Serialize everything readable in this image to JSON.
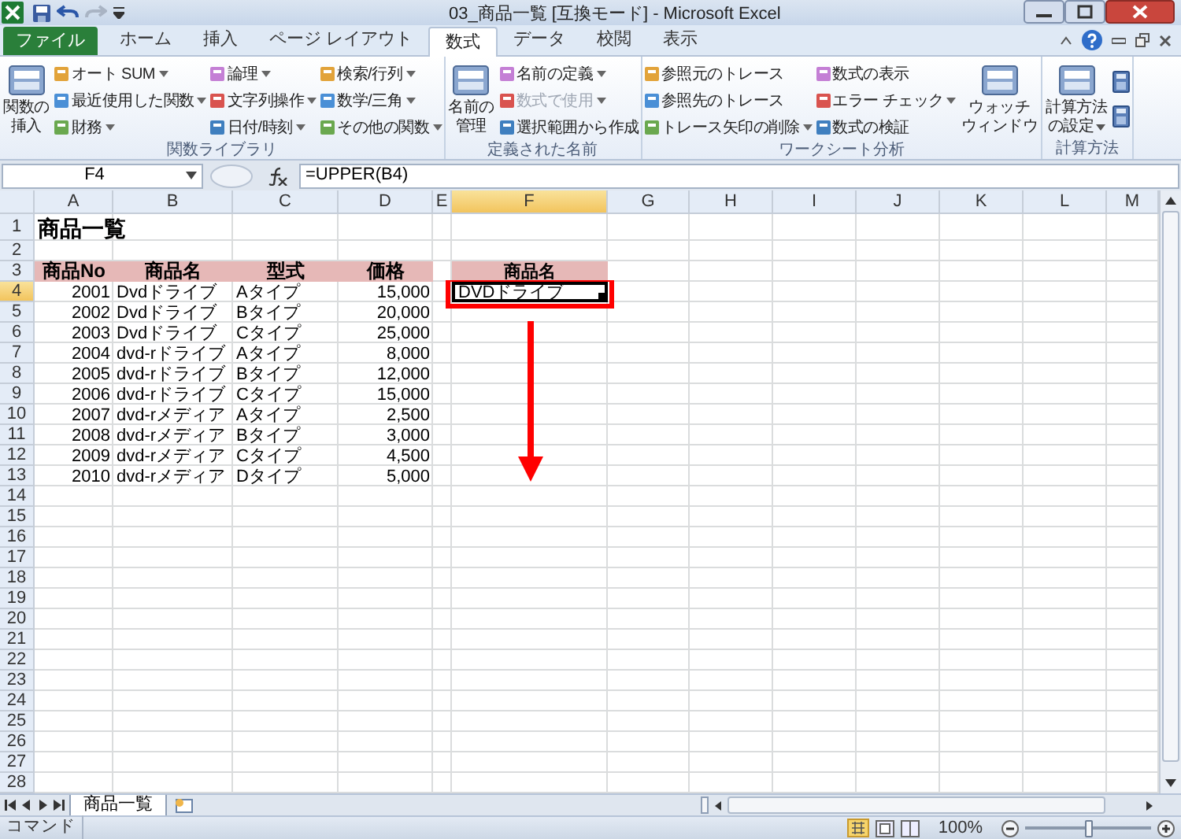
{
  "window": {
    "title": "03_商品一覧 [互換モード] - Microsoft Excel"
  },
  "tabs": [
    {
      "label": "ファイル",
      "kind": "file",
      "selected": false
    },
    {
      "label": "ホーム",
      "kind": "tab",
      "selected": false
    },
    {
      "label": "挿入",
      "kind": "tab",
      "selected": false
    },
    {
      "label": "ページ レイアウト",
      "kind": "tab",
      "selected": false
    },
    {
      "label": "数式",
      "kind": "tab",
      "selected": true
    },
    {
      "label": "データ",
      "kind": "tab",
      "selected": false
    },
    {
      "label": "校閲",
      "kind": "tab",
      "selected": false
    },
    {
      "label": "表示",
      "kind": "tab",
      "selected": false
    }
  ],
  "ribbon": {
    "groups": [
      {
        "name": "関数ライブラリ",
        "items": [
          {
            "kind": "big",
            "lines": [
              "関数の",
              "挿入"
            ],
            "dropdown": false
          },
          {
            "kind": "small",
            "label": "オート SUM",
            "dropdown": true,
            "disabled": false
          },
          {
            "kind": "small",
            "label": "最近使用した関数",
            "dropdown": true,
            "disabled": false
          },
          {
            "kind": "small",
            "label": "財務",
            "dropdown": true,
            "disabled": false
          },
          {
            "kind": "small",
            "label": "論理",
            "dropdown": true,
            "disabled": false
          },
          {
            "kind": "small",
            "label": "文字列操作",
            "dropdown": true,
            "disabled": false
          },
          {
            "kind": "small",
            "label": "日付/時刻",
            "dropdown": true,
            "disabled": false
          },
          {
            "kind": "small",
            "label": "検索/行列",
            "dropdown": true,
            "disabled": false
          },
          {
            "kind": "small",
            "label": "数学/三角",
            "dropdown": true,
            "disabled": false
          },
          {
            "kind": "small",
            "label": "その他の関数",
            "dropdown": true,
            "disabled": false
          }
        ]
      },
      {
        "name": "定義された名前",
        "items": [
          {
            "kind": "big",
            "lines": [
              "名前の",
              "管理"
            ],
            "dropdown": false
          },
          {
            "kind": "small",
            "label": "名前の定義",
            "dropdown": true,
            "disabled": false
          },
          {
            "kind": "small",
            "label": "数式で使用",
            "dropdown": true,
            "disabled": true
          },
          {
            "kind": "small",
            "label": "選択範囲から作成",
            "dropdown": false,
            "disabled": false
          }
        ]
      },
      {
        "name": "ワークシート分析",
        "items": [
          {
            "kind": "small",
            "label": "参照元のトレース",
            "dropdown": false,
            "disabled": false
          },
          {
            "kind": "small",
            "label": "参照先のトレース",
            "dropdown": false,
            "disabled": false
          },
          {
            "kind": "small",
            "label": "トレース矢印の削除",
            "dropdown": true,
            "disabled": false
          },
          {
            "kind": "small",
            "label": "数式の表示",
            "dropdown": false,
            "disabled": false
          },
          {
            "kind": "small",
            "label": "エラー チェック",
            "dropdown": true,
            "disabled": false
          },
          {
            "kind": "small",
            "label": "数式の検証",
            "dropdown": false,
            "disabled": false
          },
          {
            "kind": "big",
            "lines": [
              "ウォッチ",
              "ウィンドウ"
            ],
            "dropdown": false
          }
        ]
      },
      {
        "name": "計算方法",
        "items": [
          {
            "kind": "big",
            "lines": [
              "計算方法",
              "の設定"
            ],
            "dropdown": true
          },
          {
            "kind": "icon"
          },
          {
            "kind": "icon"
          }
        ]
      }
    ]
  },
  "formula_bar": {
    "name_box": "F4",
    "formula": "=UPPER(B4)"
  },
  "sheet": {
    "columns": [
      {
        "label": "A",
        "selected": false
      },
      {
        "label": "B",
        "selected": false
      },
      {
        "label": "C",
        "selected": false
      },
      {
        "label": "D",
        "selected": false
      },
      {
        "label": "E",
        "selected": false
      },
      {
        "label": "F",
        "selected": true
      },
      {
        "label": "G",
        "selected": false
      },
      {
        "label": "H",
        "selected": false
      },
      {
        "label": "I",
        "selected": false
      },
      {
        "label": "J",
        "selected": false
      },
      {
        "label": "K",
        "selected": false
      },
      {
        "label": "L",
        "selected": false
      },
      {
        "label": "M",
        "selected": false
      }
    ],
    "rows": [
      {
        "label": "1",
        "kind": "title",
        "selected": false,
        "cells": [
          "商品一覧"
        ]
      },
      {
        "label": "2",
        "kind": "blank",
        "selected": false
      },
      {
        "label": "3",
        "kind": "header",
        "selected": false,
        "cells": [
          "商品No",
          "商品名",
          "型式",
          "価格"
        ],
        "column_f": {
          "text": "商品名",
          "selected": false
        }
      },
      {
        "label": "4",
        "kind": "data",
        "selected": true,
        "cells": [
          "2001",
          "Dvdドライブ",
          "Aタイプ",
          "15,000"
        ],
        "column_f": {
          "text": "DVDドライブ",
          "selected": true
        }
      },
      {
        "label": "5",
        "kind": "data",
        "selected": false,
        "cells": [
          "2002",
          "Dvdドライブ",
          "Bタイプ",
          "20,000"
        ]
      },
      {
        "label": "6",
        "kind": "data",
        "selected": false,
        "cells": [
          "2003",
          "Dvdドライブ",
          "Cタイプ",
          "25,000"
        ]
      },
      {
        "label": "7",
        "kind": "data",
        "selected": false,
        "cells": [
          "2004",
          "dvd-rドライブ",
          "Aタイプ",
          "8,000"
        ]
      },
      {
        "label": "8",
        "kind": "data",
        "selected": false,
        "cells": [
          "2005",
          "dvd-rドライブ",
          "Bタイプ",
          "12,000"
        ]
      },
      {
        "label": "9",
        "kind": "data",
        "selected": false,
        "cells": [
          "2006",
          "dvd-rドライブ",
          "Cタイプ",
          "15,000"
        ]
      },
      {
        "label": "10",
        "kind": "data",
        "selected": false,
        "cells": [
          "2007",
          "dvd-rメディア",
          "Aタイプ",
          "2,500"
        ]
      },
      {
        "label": "11",
        "kind": "data",
        "selected": false,
        "cells": [
          "2008",
          "dvd-rメディア",
          "Bタイプ",
          "3,000"
        ]
      },
      {
        "label": "12",
        "kind": "data",
        "selected": false,
        "cells": [
          "2009",
          "dvd-rメディア",
          "Cタイプ",
          "4,500"
        ]
      },
      {
        "label": "13",
        "kind": "data",
        "selected": false,
        "cells": [
          "2010",
          "dvd-rメディア",
          "Dタイプ",
          "5,000"
        ]
      },
      {
        "label": "14",
        "kind": "blank",
        "selected": false
      },
      {
        "label": "15",
        "kind": "blank",
        "selected": false
      },
      {
        "label": "16",
        "kind": "blank",
        "selected": false
      },
      {
        "label": "17",
        "kind": "blank",
        "selected": false
      },
      {
        "label": "18",
        "kind": "blank",
        "selected": false
      },
      {
        "label": "19",
        "kind": "blank",
        "selected": false
      },
      {
        "label": "20",
        "kind": "blank",
        "selected": false
      },
      {
        "label": "21",
        "kind": "blank",
        "selected": false
      },
      {
        "label": "22",
        "kind": "blank",
        "selected": false
      },
      {
        "label": "23",
        "kind": "blank",
        "selected": false
      },
      {
        "label": "24",
        "kind": "blank",
        "selected": false
      },
      {
        "label": "25",
        "kind": "blank",
        "selected": false
      },
      {
        "label": "26",
        "kind": "blank",
        "selected": false
      },
      {
        "label": "27",
        "kind": "blank",
        "selected": false
      },
      {
        "label": "28",
        "kind": "blank",
        "selected": false
      }
    ]
  },
  "sheet_tabs": [
    {
      "label": "商品一覧",
      "selected": true
    }
  ],
  "status_bar": {
    "mode": "コマンド",
    "zoom": "100%",
    "zoom_slider": {
      "level": 0.5
    }
  }
}
